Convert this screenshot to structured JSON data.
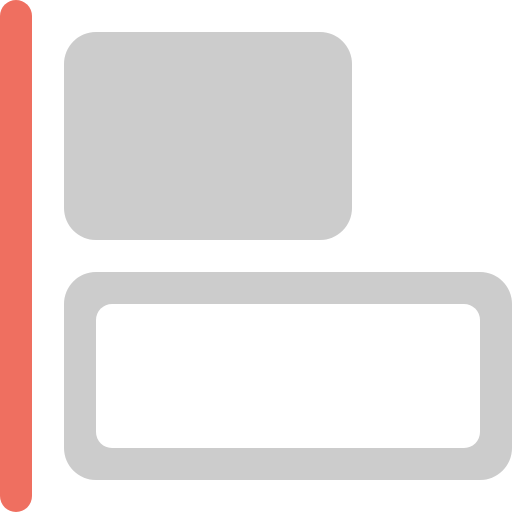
{
  "icon": {
    "name": "align-left-icon",
    "colors": {
      "alignment_bar": "#EF6F60",
      "shape_fill": "#CCCCCC",
      "inner_fill": "#FFFFFF",
      "background": "#FFFFFF"
    }
  }
}
